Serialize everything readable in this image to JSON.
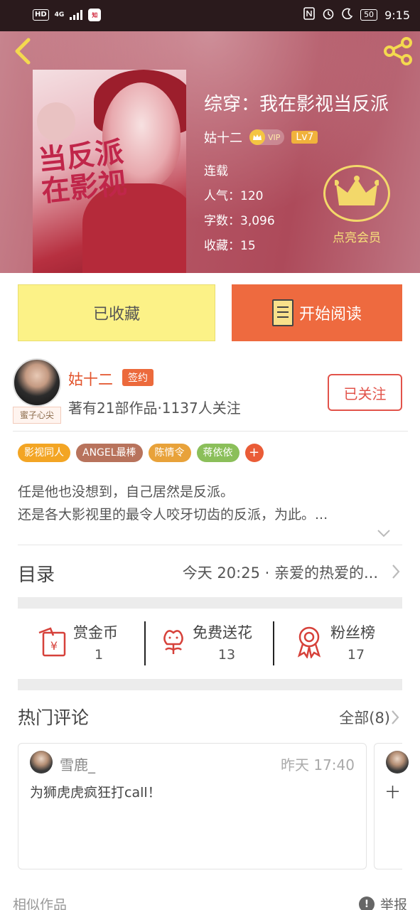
{
  "status_bar": {
    "hd": "HD",
    "network": "4G",
    "time": "9:15",
    "battery": "50"
  },
  "book": {
    "title": "综穿：我在影视当反派",
    "author": "姑十二",
    "vip_label": "VIP",
    "level": "Lv7",
    "status": "连载",
    "popularity": "人气：120",
    "word_count": "字数：3,096",
    "favorites": "收藏：15",
    "cover_title": "当反派 在影视"
  },
  "member": {
    "label": "点亮会员"
  },
  "actions": {
    "favorited_label": "已收藏",
    "read_label": "开始阅读"
  },
  "author": {
    "name": "姑十二",
    "badge": "签约",
    "tag": "蜜子心尖",
    "info": "著有21部作品·1137人关注",
    "follow_label": "已关注"
  },
  "tags": [
    {
      "label": "影视同人",
      "color": "#f3a524"
    },
    {
      "label": "ANGEL最棒",
      "color": "#b8735c"
    },
    {
      "label": "陈情令",
      "color": "#e8a23a"
    },
    {
      "label": "蒋依依",
      "color": "#8bbf5a"
    }
  ],
  "synopsis": {
    "line1": "任是他也没想到，自己居然是反派。",
    "line2": "还是各大影视里的最令人咬牙切齿的反派，为此。..."
  },
  "catalog": {
    "label": "目录",
    "latest": "今天 20:25 · 亲爱的热爱的..."
  },
  "gifts": [
    {
      "name": "赏金币",
      "value": "1"
    },
    {
      "name": "免费送花",
      "value": "13"
    },
    {
      "name": "粉丝榜",
      "value": "17"
    }
  ],
  "comments": {
    "title": "热门评论",
    "all_label": "全部(8)",
    "items": [
      {
        "user": "雪鹿_",
        "time": "昨天 17:40",
        "text": "为狮虎虎疯狂打call！"
      },
      {
        "user": "",
        "time": "",
        "text": "十"
      }
    ]
  },
  "footer": {
    "similar": "相似作品",
    "report": "举报"
  },
  "colors": {
    "accent": "#ee6a3f",
    "favorite_bg": "#fcf287",
    "author_name": "#e2532b"
  }
}
